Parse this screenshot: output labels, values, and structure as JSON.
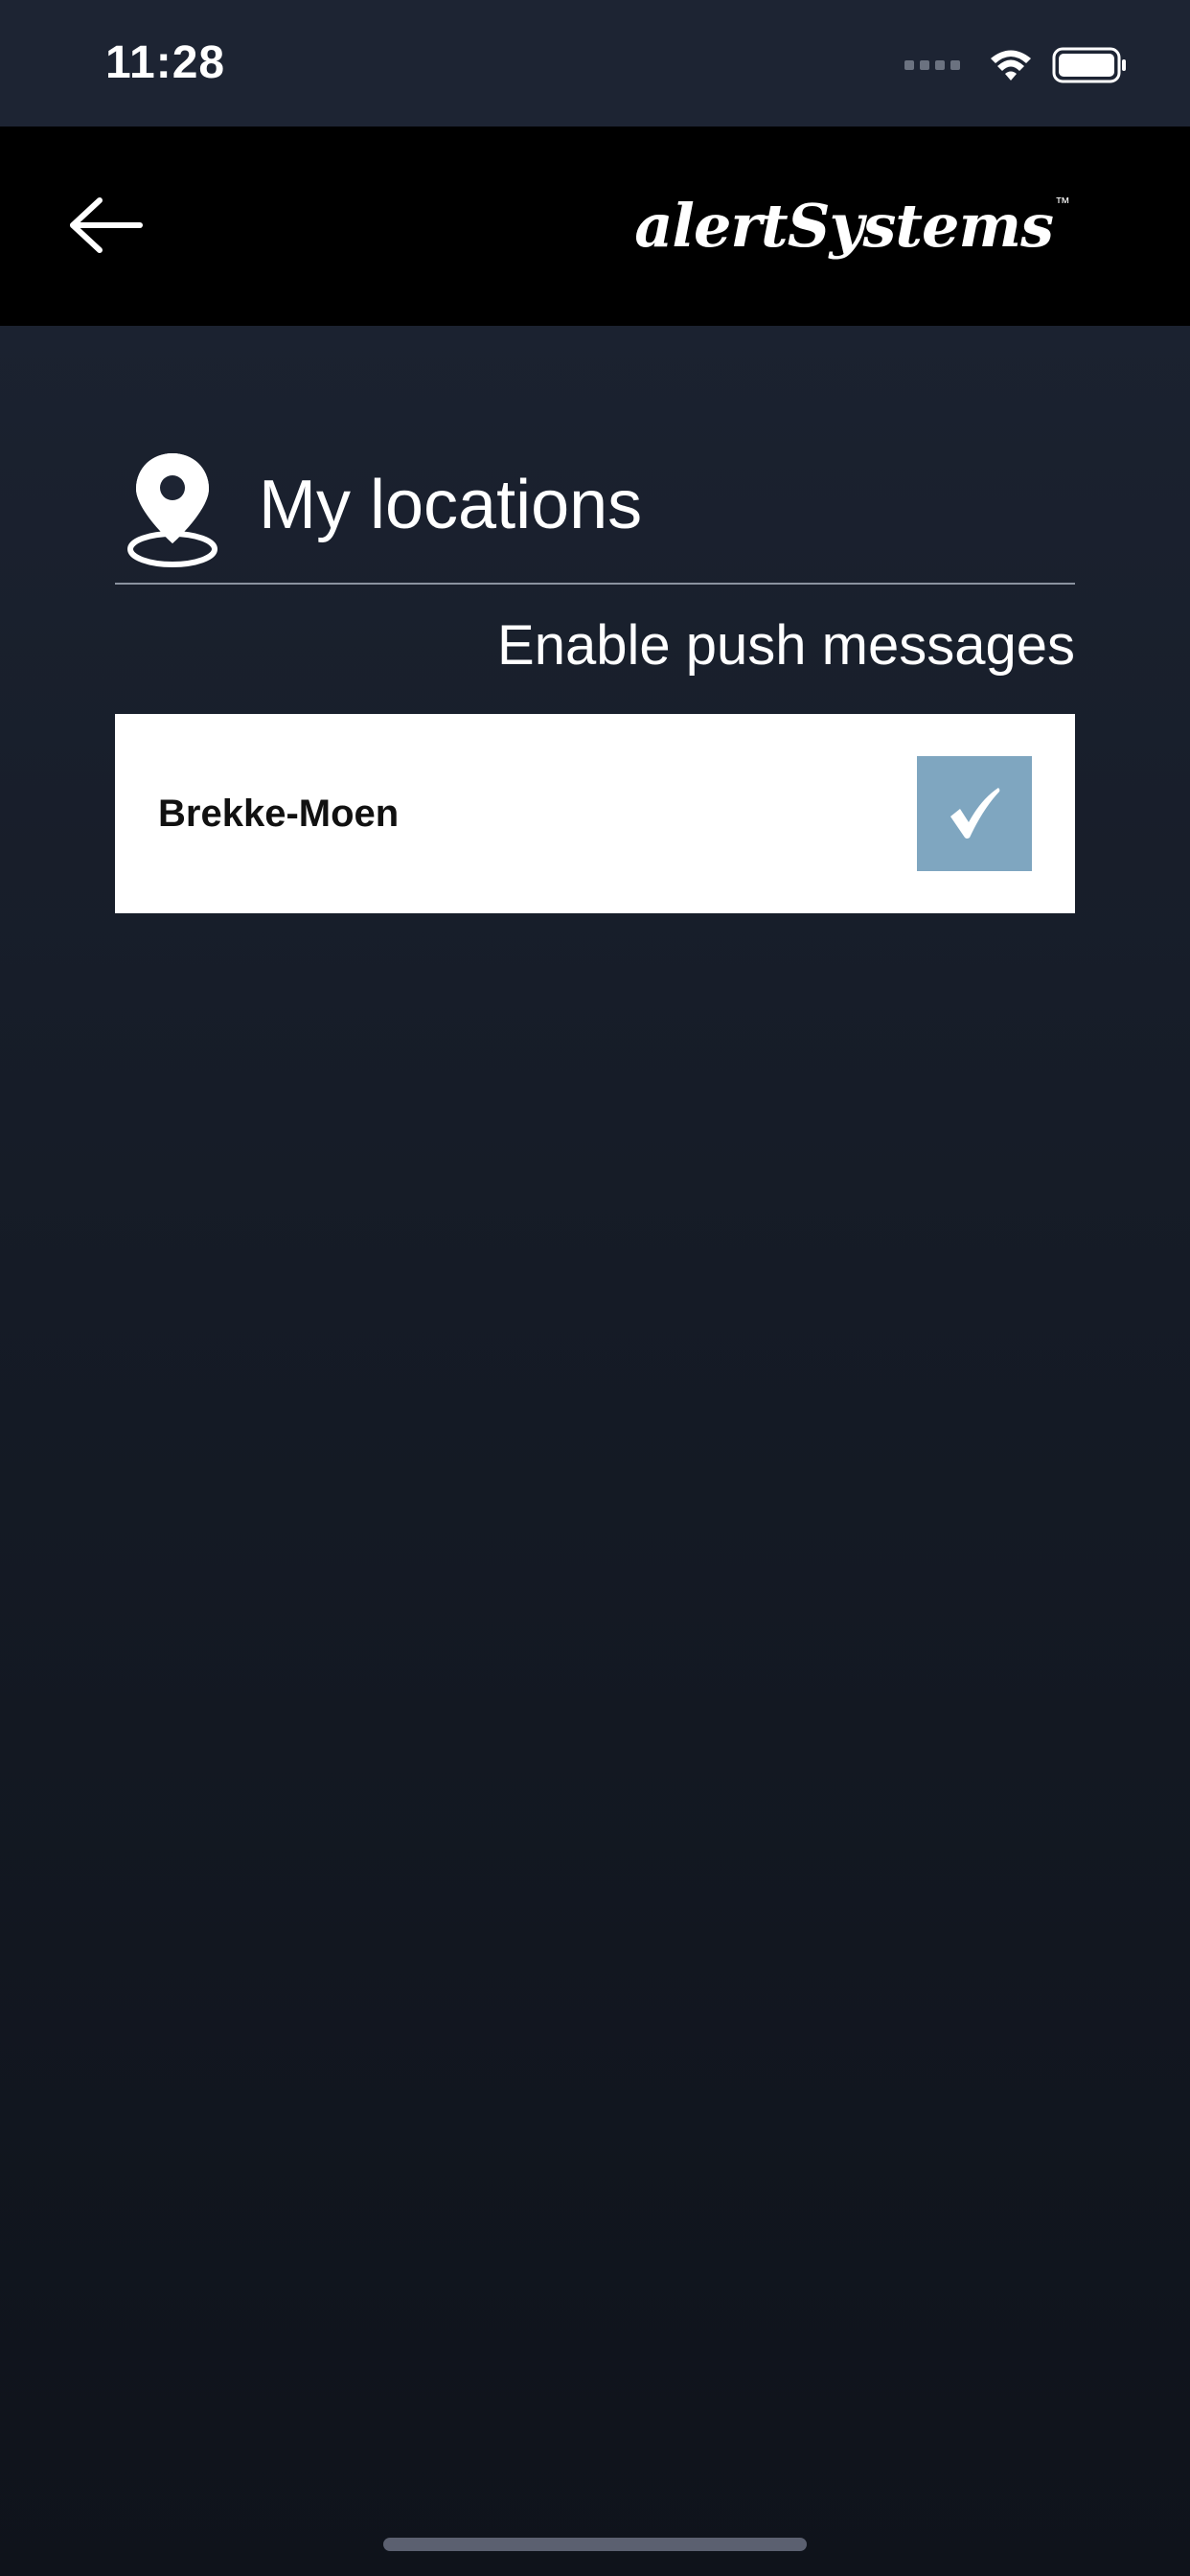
{
  "status_bar": {
    "time": "11:28",
    "icons": [
      "signal-icon",
      "wifi-icon",
      "battery-icon"
    ]
  },
  "app_bar": {
    "back_icon": "arrow-left-icon",
    "logo_text": "alertSystems",
    "logo_tm": "™"
  },
  "section": {
    "icon": "location-pin-icon",
    "title": "My locations",
    "push_label": "Enable push messages"
  },
  "locations": [
    {
      "name": "Brekke-Moen",
      "push_enabled": true
    }
  ],
  "colors": {
    "background_top": "#1d2433",
    "background_bottom": "#0f131b",
    "app_bar": "#000000",
    "checkbox": "#7fa6c0",
    "row_background": "#ffffff"
  }
}
